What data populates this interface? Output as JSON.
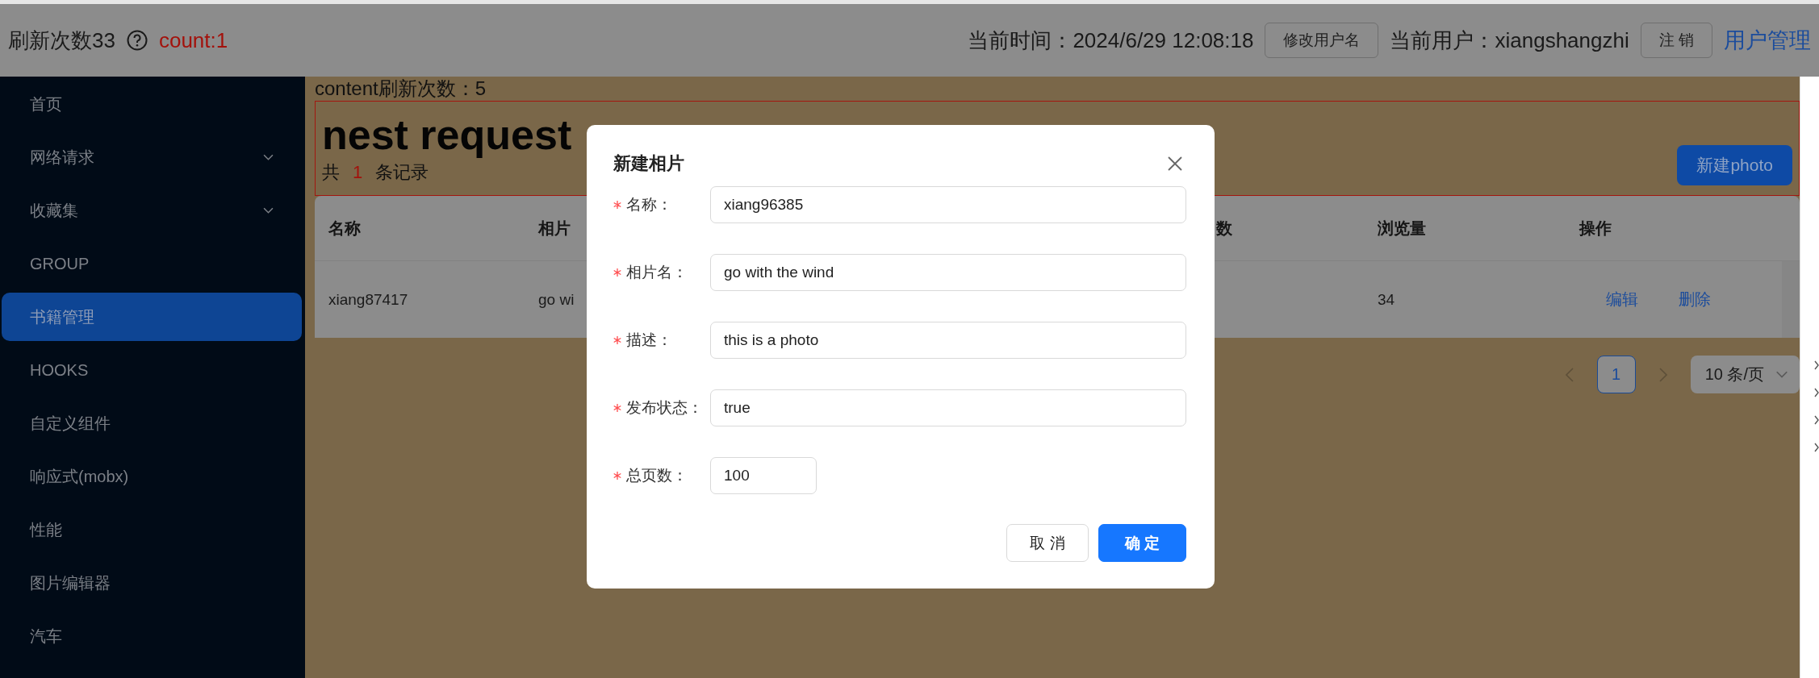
{
  "header": {
    "refresh_count": "刷新次数33",
    "count": "count:1",
    "time": "当前时间：2024/6/29 12:08:18",
    "rename_button": "修改用户名",
    "user": "当前用户：xiangshangzhi",
    "logout_button": "注 销",
    "admin_link": "用户管理"
  },
  "sidebar": {
    "items": [
      {
        "label": "首页",
        "selected": false
      },
      {
        "label": "网络请求",
        "selected": false,
        "expanded": false
      },
      {
        "label": "收藏集",
        "selected": false,
        "expanded": false
      },
      {
        "label": "GROUP",
        "selected": false
      },
      {
        "label": "书籍管理",
        "selected": true
      },
      {
        "label": "HOOKS",
        "selected": false
      },
      {
        "label": "自定义组件",
        "selected": false
      },
      {
        "label": "响应式(mobx)",
        "selected": false
      },
      {
        "label": "性能",
        "selected": false
      },
      {
        "label": "图片编辑器",
        "selected": false
      },
      {
        "label": "汽车",
        "selected": false
      }
    ]
  },
  "content": {
    "refresh_label": "content刷新次数：5",
    "title": "nest request",
    "total": {
      "prefix": "共",
      "count": "1",
      "suffix": "条记录"
    },
    "new_button": "新建photo"
  },
  "table": {
    "columns": [
      "名称",
      "相片",
      "数",
      "浏览量",
      "操作"
    ],
    "rows": [
      {
        "name": "xiang87417",
        "photo_name": "go wi",
        "views": "34",
        "actions": [
          "编辑",
          "删除"
        ]
      }
    ]
  },
  "pagination": {
    "pages": [
      {
        "label": "1",
        "selected": true
      }
    ],
    "page_size": "10 条/页"
  },
  "modal": {
    "title": "新建相片",
    "fields": [
      {
        "label": "名称：",
        "value": "xiang96385",
        "required": true,
        "kind": "text"
      },
      {
        "label": "相片名：",
        "value": "go with the wind",
        "required": true,
        "kind": "text"
      },
      {
        "label": "描述：",
        "value": "this is a photo",
        "required": true,
        "kind": "text"
      },
      {
        "label": "发布状态：",
        "value": "true",
        "required": true,
        "kind": "text"
      },
      {
        "label": "总页数：",
        "value": "100",
        "required": true,
        "kind": "number"
      }
    ],
    "buttons": [
      {
        "label": "取 消",
        "kind": "default"
      },
      {
        "label": "确 定",
        "kind": "primary"
      }
    ]
  }
}
